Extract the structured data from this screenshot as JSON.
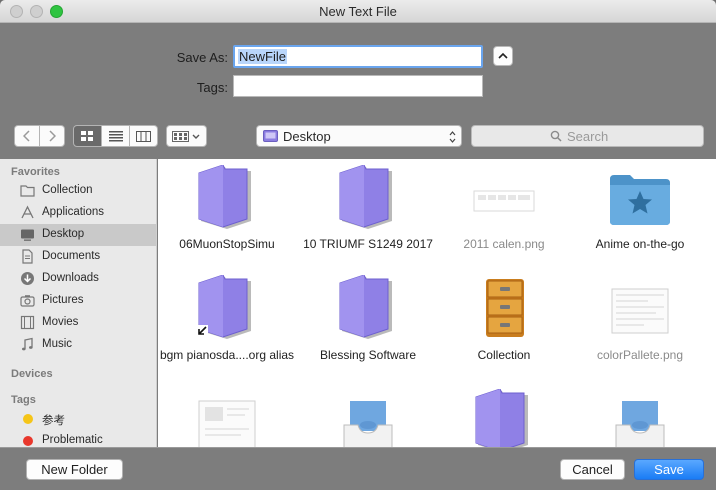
{
  "window": {
    "title": "New Text File"
  },
  "save_panel": {
    "save_as_label": "Save As:",
    "save_as_value": "NewFile",
    "tags_label": "Tags:",
    "tags_value": ""
  },
  "toolbar": {
    "back_icon": "chevron-left-icon",
    "forward_icon": "chevron-right-icon",
    "view_modes": [
      "icon-view",
      "list-view",
      "column-view"
    ],
    "selected_view": "icon-view",
    "location": "Desktop",
    "search_placeholder": "Search"
  },
  "sidebar": {
    "favorites_heading": "Favorites",
    "favorites": [
      {
        "label": "Collection",
        "icon": "folder-icon",
        "selected": false
      },
      {
        "label": "Applications",
        "icon": "applications-icon",
        "selected": false
      },
      {
        "label": "Desktop",
        "icon": "desktop-icon",
        "selected": true
      },
      {
        "label": "Documents",
        "icon": "document-icon",
        "selected": false
      },
      {
        "label": "Downloads",
        "icon": "download-icon",
        "selected": false
      },
      {
        "label": "Pictures",
        "icon": "camera-icon",
        "selected": false
      },
      {
        "label": "Movies",
        "icon": "film-icon",
        "selected": false
      },
      {
        "label": "Music",
        "icon": "music-icon",
        "selected": false
      }
    ],
    "devices_heading": "Devices",
    "tags_heading": "Tags",
    "tags": [
      {
        "label": "参考",
        "color": "#f5c518"
      },
      {
        "label": "Problematic",
        "color": "#e8372c"
      }
    ]
  },
  "files": [
    {
      "name": "06MuonStopSimu",
      "type": "folder",
      "dim": false
    },
    {
      "name": "10 TRIUMF S1249 2017",
      "type": "folder",
      "dim": false
    },
    {
      "name": "2011 calen.png",
      "type": "image-thumb",
      "dim": true
    },
    {
      "name": "Anime on-the-go",
      "type": "blue-folder",
      "dim": false
    },
    {
      "name": "bgm pianosda....org alias",
      "type": "alias-folder",
      "dim": false
    },
    {
      "name": "Blessing Software",
      "type": "folder",
      "dim": false
    },
    {
      "name": "Collection",
      "type": "cabinet",
      "dim": false
    },
    {
      "name": "colorPallete.png",
      "type": "screenshot-thumb",
      "dim": true
    },
    {
      "name": "",
      "type": "screenshot-thumb",
      "dim": false
    },
    {
      "name": "",
      "type": "tray",
      "dim": false
    },
    {
      "name": "",
      "type": "folder",
      "dim": false
    },
    {
      "name": "",
      "type": "tray",
      "dim": false
    }
  ],
  "buttons": {
    "new_folder": "New Folder",
    "cancel": "Cancel",
    "save": "Save"
  },
  "colors": {
    "accent": "#1a7cf5",
    "folder_purple": "#8f80e6",
    "selection": "#b9d6fb"
  }
}
